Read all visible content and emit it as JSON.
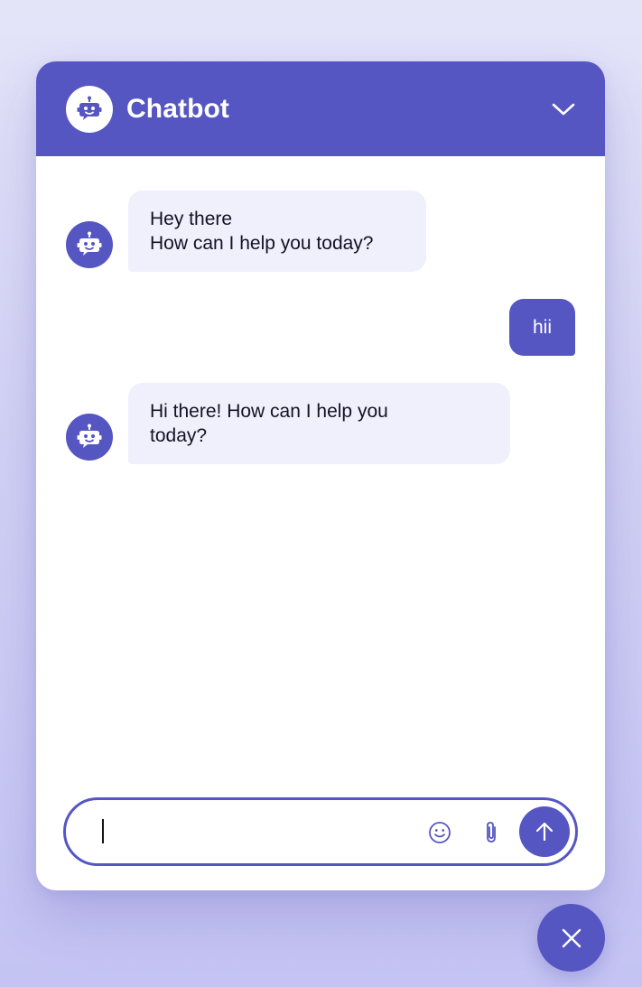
{
  "header": {
    "title": "Chatbot",
    "logo_icon": "chatbot-icon",
    "collapse_icon": "chevron-down-icon"
  },
  "messages": [
    {
      "sender": "bot",
      "lines": [
        "Hey there",
        "How can I help you today?"
      ]
    },
    {
      "sender": "user",
      "lines": [
        "hii"
      ]
    },
    {
      "sender": "bot",
      "lines": [
        "Hi there! How can I help you",
        "today?"
      ]
    }
  ],
  "composer": {
    "value": "",
    "emoji_icon": "smiley-icon",
    "attach_icon": "paperclip-icon",
    "send_icon": "arrow-up-icon"
  },
  "close_fab": {
    "icon": "close-icon"
  },
  "colors": {
    "accent": "#5556c2",
    "bot_bubble": "#f0f0fd",
    "text": "#121225"
  }
}
